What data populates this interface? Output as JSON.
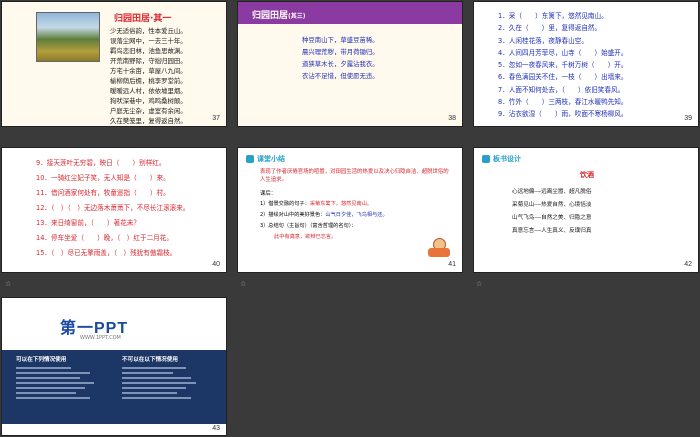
{
  "slides": [
    {
      "number": "37",
      "title": "归园田居·其一",
      "lines": [
        "少无适俗韵，性本爱丘山。",
        "误落尘网中，一去三十年。",
        "羁鸟恋旧林，池鱼思故渊。",
        "开荒南野际，守拙归园田。",
        "方宅十余亩，草屋八九间。",
        "榆柳荫后檐，桃李罗堂前。",
        "暧暧远人村，依依墟里烟。",
        "狗吠深巷中，鸡鸣桑树颠。",
        "户庭无尘杂，虚室有余闲。",
        "久在樊笼里，复得返自然。"
      ]
    },
    {
      "number": "38",
      "title": "归园田居",
      "subtitle": "(其三)",
      "lines": [
        "种豆南山下，草盛豆苗稀。",
        "晨兴理荒秽，带月荷锄归。",
        "道狭草木长，夕露沾我衣。",
        "衣沾不足惜，但使愿无违。"
      ]
    },
    {
      "number": "39",
      "lines": [
        "1．采（　　）东篱下，悠然见南山。",
        "2．久在（　　）里，复得返自然。",
        "3．人闲桂花落，夜静春山空。",
        "4．人间四月芳菲尽，山寺（　　）始盛开。",
        "5．忽如一夜春风来，千树万树（　　）开。",
        "6．春色满园关不住，一枝（　　）出墙来。",
        "7．人面不知何处去，（　　）依旧笑春风。",
        "8．竹外（　　）三两枝，春江水暖鸭先知。",
        "9．沾衣欲湿（　　）雨，吹面不寒杨柳风。"
      ]
    },
    {
      "number": "40",
      "lines": [
        "9．接天莲叶无穷碧，映日（　　）别样红。",
        "10．一骑红尘妃子笑，无人知是（　　）来。",
        "11．借问酒家何处有，牧童遥指（　　）村。",
        "12．（　）（　）无边落木萧萧下，不尽长江滚滚来。",
        "13．来日绮窗前，（　　）著花未？",
        "14．停车坐爱（　　）晚，（　）红于二月花。",
        "15．（　）尽已无擎雨盖，（　）残犹有傲霜枝。"
      ]
    },
    {
      "number": "41",
      "heading": "课堂小结",
      "summary": "表现了作者厌倦官场的喧嚣，对田园生活的热爱以及决心归隐自洁、超脱世俗的人生追求。",
      "review_label": "课后：",
      "items": [
        {
          "q": "1）借景交融的句子：",
          "a": "采菊东篱下，悠然见南山。"
        },
        {
          "q": "2）描绘对山中的美好景色：",
          "a": "山气日夕佳，飞鸟相与还。"
        },
        {
          "q": "3）总结句（主旨句）（富含哲理的名句）：",
          "a": ""
        },
        {
          "q": "",
          "a": "此中有真意，欲辩已忘言。"
        }
      ]
    },
    {
      "number": "42",
      "heading": "板书设计",
      "title": "饮酒",
      "lines": [
        "心远地偏——远离尘嚣、超凡脱俗",
        "采菊见山——热爱自然、心境恬淡",
        "山气飞鸟——自然之美、归隐之意",
        "真意忘言——人生真义、反璞归真"
      ]
    },
    {
      "number": "43",
      "logo": "第一PPT",
      "url": "WWW.1PPT.COM",
      "can_use": "可以在下列情况使用",
      "cannot_use": "不可以在以下情况使用"
    }
  ],
  "star": "☆"
}
